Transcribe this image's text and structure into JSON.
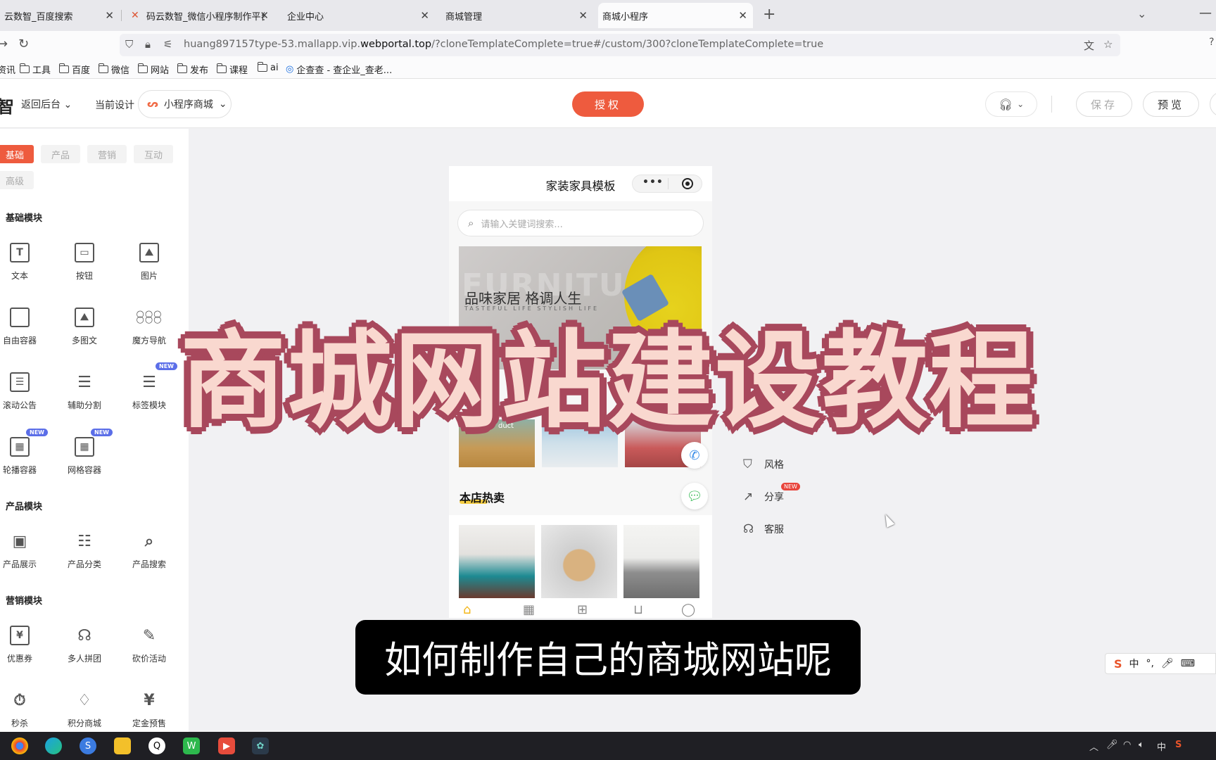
{
  "browser": {
    "tabs": [
      {
        "title": "云数智_百度搜索",
        "active": false
      },
      {
        "title": "码云数智_微信小程序制作平台",
        "active": false
      },
      {
        "title": "企业中心",
        "active": false
      },
      {
        "title": "商城管理",
        "active": false
      },
      {
        "title": "商城小程序",
        "active": true
      }
    ],
    "url_prefix": "huang897157type-53.mallapp.vip.",
    "url_domain": "webportal.top",
    "url_suffix": "/?cloneTemplateComplete=true#/custom/300?cloneTemplateComplete=true",
    "bookmarks": [
      "资讯",
      "工具",
      "百度",
      "微信",
      "网站",
      "发布",
      "课程",
      "ai",
      "企查查 - 查企业_查老..."
    ]
  },
  "header": {
    "brand_glyph": "智",
    "back_label": "返回后台",
    "current_design_label": "当前设计",
    "current_design_value": "小程序商城",
    "auth_label": "授权",
    "save_label": "保存",
    "preview_label": "预览"
  },
  "left_panel": {
    "tabs": [
      "基础",
      "产品",
      "营销",
      "互动",
      "高级"
    ],
    "active_tab": "基础",
    "sections": [
      {
        "title": "基础模块",
        "items": [
          {
            "label": "文本",
            "icon": "text-icon"
          },
          {
            "label": "按钮",
            "icon": "button-icon"
          },
          {
            "label": "图片",
            "icon": "image-icon"
          },
          {
            "label": "自由容器",
            "icon": "free-container-icon"
          },
          {
            "label": "多图文",
            "icon": "multi-image-text-icon"
          },
          {
            "label": "魔方导航",
            "icon": "cube-nav-icon"
          },
          {
            "label": "滚动公告",
            "icon": "scroll-notice-icon"
          },
          {
            "label": "辅助分割",
            "icon": "divider-icon"
          },
          {
            "label": "标签模块",
            "icon": "tag-module-icon",
            "badge": "NEW"
          },
          {
            "label": "轮播容器",
            "icon": "carousel-container-icon",
            "badge": "NEW"
          },
          {
            "label": "网格容器",
            "icon": "grid-container-icon",
            "badge": "NEW"
          }
        ]
      },
      {
        "title": "产品模块",
        "items": [
          {
            "label": "产品展示",
            "icon": "product-display-icon"
          },
          {
            "label": "产品分类",
            "icon": "product-category-icon"
          },
          {
            "label": "产品搜索",
            "icon": "product-search-icon"
          }
        ]
      },
      {
        "title": "营销模块",
        "items": [
          {
            "label": "优惠券",
            "icon": "coupon-icon"
          },
          {
            "label": "多人拼团",
            "icon": "group-buy-icon"
          },
          {
            "label": "砍价活动",
            "icon": "bargain-icon"
          },
          {
            "label": "秒杀",
            "icon": "flash-sale-icon"
          },
          {
            "label": "积分商城",
            "icon": "points-mall-icon"
          },
          {
            "label": "定金预售",
            "icon": "presale-icon"
          }
        ]
      }
    ]
  },
  "phone": {
    "title": "家装家具模板",
    "search_placeholder": "请输入关键词搜索...",
    "banner_slogan": "品味家居 格调人生",
    "banner_sub": "TASTEFUL LIFE STYLISH LIFE",
    "banner_bg_word": "FURNITURE",
    "thumb_label": "duct",
    "hot_title": "本店热卖"
  },
  "settings": {
    "items": [
      {
        "label": "风格",
        "icon": "shirt-icon"
      },
      {
        "label": "分享",
        "icon": "share-icon",
        "badge": "NEW"
      },
      {
        "label": "客服",
        "icon": "headset-icon"
      }
    ]
  },
  "overlay_title": "商城网站建设教程",
  "subtitle": "如何制作自己的商城网站呢",
  "ime": {
    "mode": "中"
  },
  "colors": {
    "accent": "#ee5b3e",
    "overlay_fill": "#f9d8cf",
    "overlay_stroke": "#a8485c",
    "new_badge": "#5b6ee8"
  }
}
